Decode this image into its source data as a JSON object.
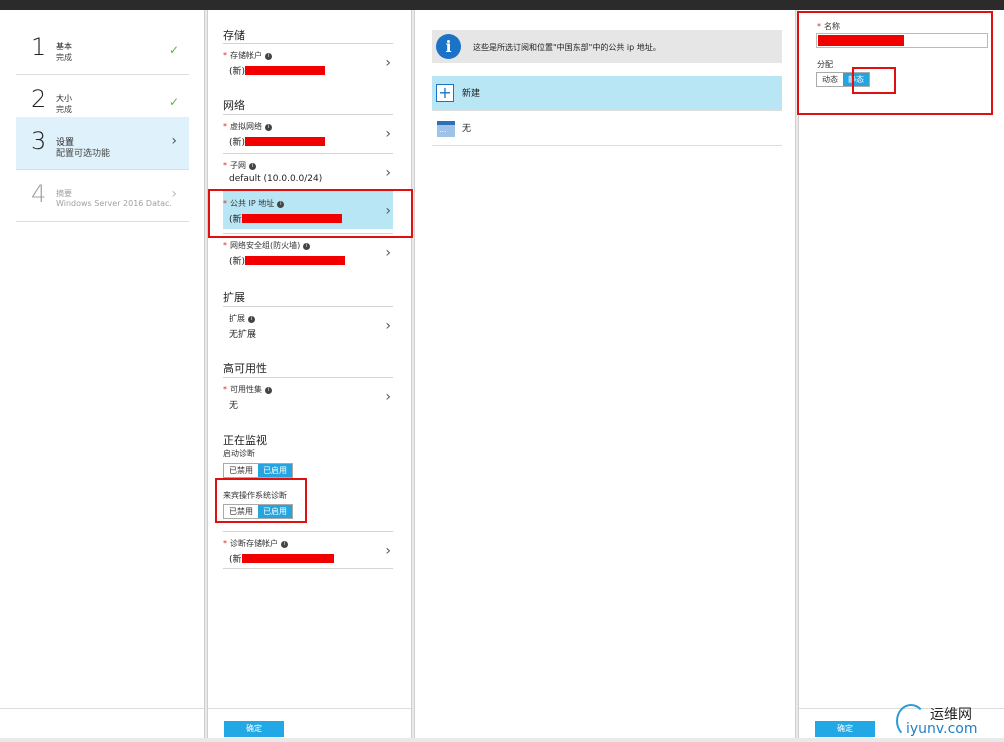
{
  "steps": [
    {
      "num": "1",
      "title": "基本",
      "subtitle": "完成",
      "state": "done"
    },
    {
      "num": "2",
      "title": "大小",
      "subtitle": "完成",
      "state": "done"
    },
    {
      "num": "3",
      "title": "设置",
      "subtitle": "配置可选功能",
      "state": "active"
    },
    {
      "num": "4",
      "title": "摘要",
      "subtitle": "Windows Server 2016 Datac...",
      "state": "disabled"
    }
  ],
  "settings": {
    "storage": {
      "title": "存储",
      "account_label": "存储帐户",
      "account_value": "(新)"
    },
    "network": {
      "title": "网络",
      "vnet_label": "虚拟网络",
      "vnet_value": "(新)",
      "subnet_label": "子网",
      "subnet_value": "default (10.0.0.0/24)",
      "public_ip_label": "公共 IP 地址",
      "public_ip_value": "(新",
      "nsg_label": "网络安全组(防火墙)",
      "nsg_value": "(新)"
    },
    "extensions": {
      "title": "扩展",
      "label": "扩展",
      "value": "无扩展"
    },
    "availability": {
      "title": "高可用性",
      "label": "可用性集",
      "value": "无"
    },
    "monitoring": {
      "title": "正在监视",
      "boot_diag_label": "启动诊断",
      "guest_diag_label": "来宾操作系统诊断",
      "disabled_label": "已禁用",
      "enabled_label": "已启用",
      "storage_label": "诊断存储帐户",
      "storage_value": "(新"
    },
    "ok_label": "确定"
  },
  "ip_blade": {
    "info_text": "这些是所选订阅和位置\"中国东部\"中的公共 ip 地址。",
    "rows": [
      {
        "label": "新建",
        "icon": "plus-icon"
      },
      {
        "label": "无",
        "icon": "no-ip-icon"
      }
    ]
  },
  "config_blade": {
    "name_label": "名称",
    "assignment_label": "分配",
    "dynamic_label": "动态",
    "static_label": "静态",
    "ok_label": "确定"
  },
  "watermark": {
    "top": "运维网",
    "bottom": "iyunv.com"
  },
  "colors": {
    "accent": "#23a8e6",
    "selected_bg": "#b8e6f5",
    "active_step_bg": "#dff1fb",
    "required": "#d32f2f",
    "check": "#5fb43e",
    "annotation": "#e01010",
    "redaction": "#f20000"
  }
}
